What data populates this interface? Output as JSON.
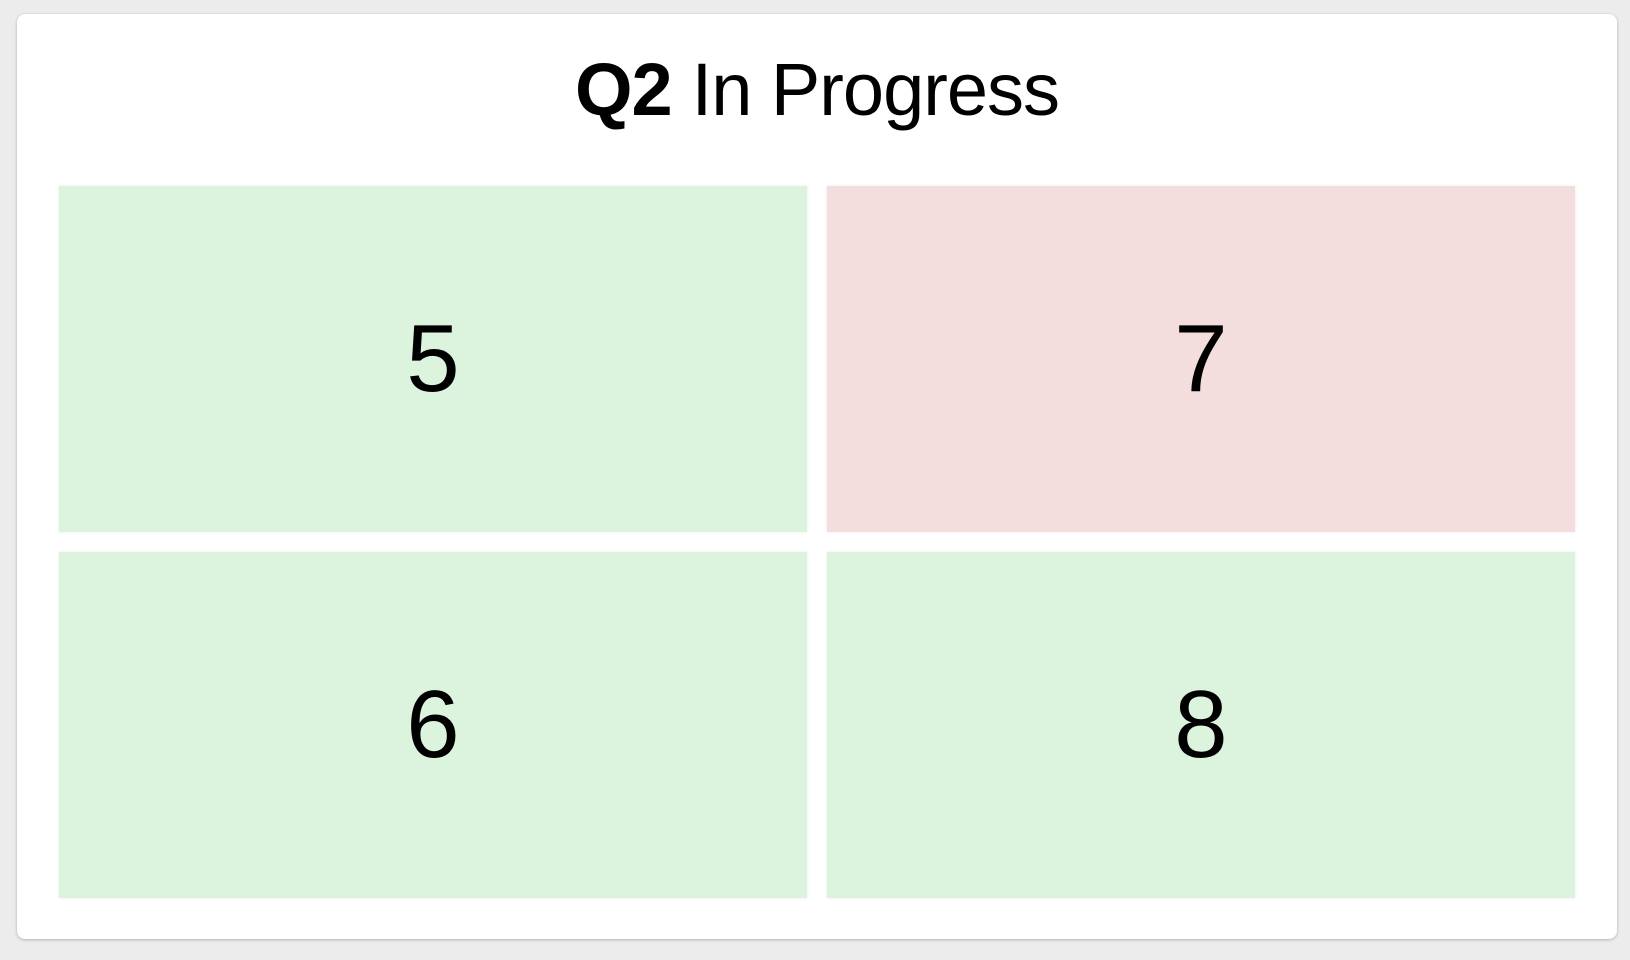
{
  "header": {
    "quarter": "Q2",
    "status": "In Progress"
  },
  "cells": [
    {
      "value": "5",
      "color": "#dcf3dd"
    },
    {
      "value": "7",
      "color": "#f3dddd"
    },
    {
      "value": "6",
      "color": "#dcf3dd"
    },
    {
      "value": "8",
      "color": "#dcf3dd"
    }
  ]
}
